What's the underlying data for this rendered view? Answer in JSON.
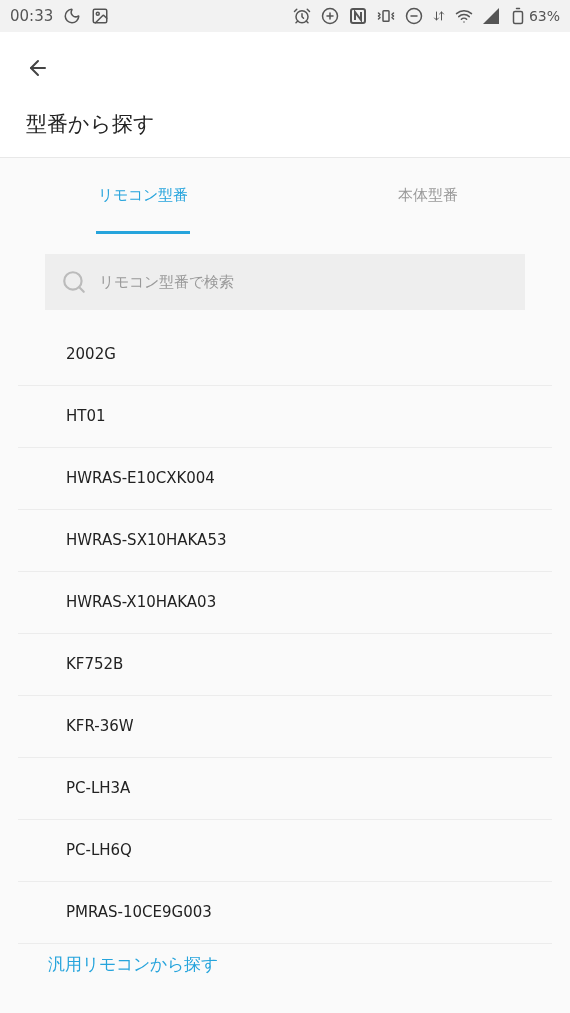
{
  "status_bar": {
    "time": "00:33",
    "battery": "63%"
  },
  "header": {
    "title": "型番から探す"
  },
  "tabs": [
    {
      "label": "リモコン型番",
      "selected": true
    },
    {
      "label": "本体型番",
      "selected": false
    }
  ],
  "search": {
    "placeholder": "リモコン型番で検索"
  },
  "items": [
    "2002G",
    "HT01",
    "HWRAS-E10CXK004",
    "HWRAS-SX10HAKA53",
    "HWRAS-X10HAKA03",
    "KF752B",
    "KFR-36W",
    "PC-LH3A",
    "PC-LH6Q",
    "PMRAS-10CE9G003"
  ],
  "footer_link": "汎用リモコンから探す"
}
